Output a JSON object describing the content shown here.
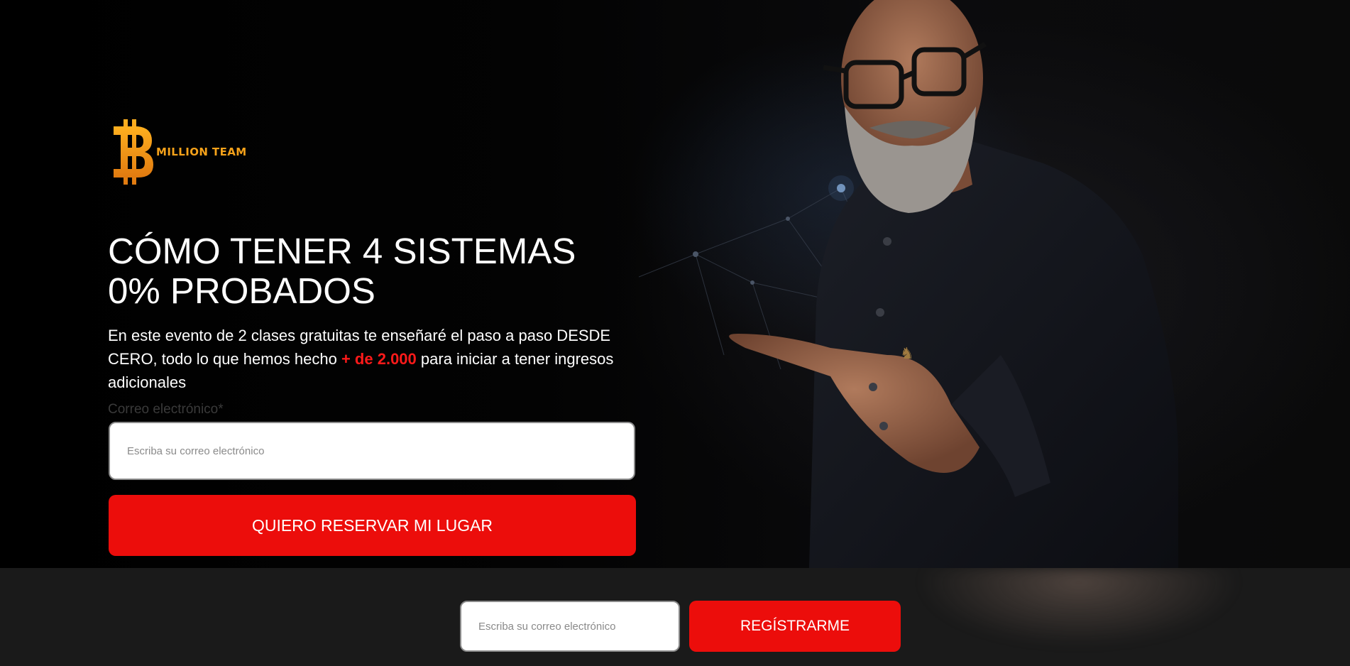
{
  "brand": {
    "name": "MILLION TEAM",
    "logo_icon": "bitcoin-b-logo",
    "accent_color": "#f6a21a"
  },
  "hero": {
    "headline_line1": "CÓMO TENER 4 SISTEMAS",
    "headline_line2": "0% PROBADOS",
    "sub_before": "En este evento de 2 clases gratuitas te enseñaré el paso a paso DESDE CERO, todo lo que hemos hecho ",
    "sub_highlight": "+ de 2.000",
    "sub_after": " para iniciar a tener ingresos adicionales",
    "highlight_color": "#ff1a1a"
  },
  "form": {
    "email_label": "Correo electrónico*",
    "email_placeholder": "Escriba su correo electrónico",
    "submit_label": "QUIERO RESERVAR MI LUGAR",
    "button_color": "#ec0d0b"
  },
  "sticky_bar": {
    "email_placeholder": "Escriba su correo electrónico",
    "submit_label": "REGÍSTRARME"
  }
}
